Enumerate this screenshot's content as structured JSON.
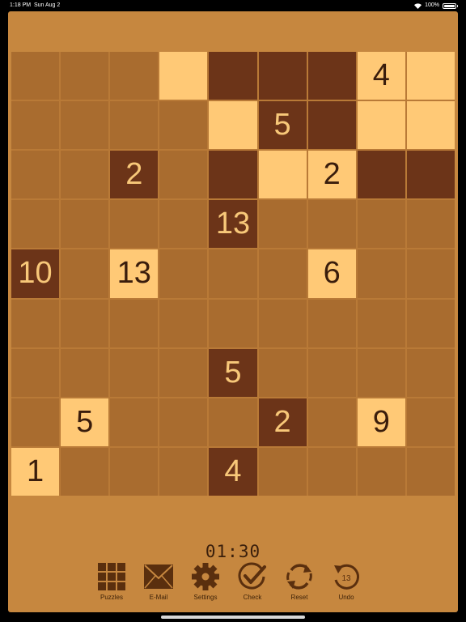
{
  "status_bar": {
    "time": "1:18 PM",
    "date": "Sun Aug 2",
    "battery": "100%",
    "battery_level": 1.0,
    "icons": [
      "wifi-icon",
      "battery-icon"
    ]
  },
  "board": {
    "size": 9,
    "rows": [
      [
        {
          "s": "b",
          "v": ""
        },
        {
          "s": "b",
          "v": ""
        },
        {
          "s": "b",
          "v": ""
        },
        {
          "s": "l",
          "v": ""
        },
        {
          "s": "d",
          "v": ""
        },
        {
          "s": "d",
          "v": ""
        },
        {
          "s": "d",
          "v": ""
        },
        {
          "s": "l",
          "v": "4"
        },
        {
          "s": "l",
          "v": ""
        }
      ],
      [
        {
          "s": "b",
          "v": ""
        },
        {
          "s": "b",
          "v": ""
        },
        {
          "s": "b",
          "v": ""
        },
        {
          "s": "b",
          "v": ""
        },
        {
          "s": "l",
          "v": ""
        },
        {
          "s": "d",
          "v": "5"
        },
        {
          "s": "d",
          "v": ""
        },
        {
          "s": "l",
          "v": ""
        },
        {
          "s": "l",
          "v": ""
        }
      ],
      [
        {
          "s": "b",
          "v": ""
        },
        {
          "s": "b",
          "v": ""
        },
        {
          "s": "d",
          "v": "2"
        },
        {
          "s": "b",
          "v": ""
        },
        {
          "s": "d",
          "v": ""
        },
        {
          "s": "l",
          "v": ""
        },
        {
          "s": "l",
          "v": "2"
        },
        {
          "s": "d",
          "v": ""
        },
        {
          "s": "d",
          "v": ""
        }
      ],
      [
        {
          "s": "b",
          "v": ""
        },
        {
          "s": "b",
          "v": ""
        },
        {
          "s": "b",
          "v": ""
        },
        {
          "s": "b",
          "v": ""
        },
        {
          "s": "d",
          "v": "13"
        },
        {
          "s": "b",
          "v": ""
        },
        {
          "s": "b",
          "v": ""
        },
        {
          "s": "b",
          "v": ""
        },
        {
          "s": "b",
          "v": ""
        }
      ],
      [
        {
          "s": "d",
          "v": "10"
        },
        {
          "s": "b",
          "v": ""
        },
        {
          "s": "l",
          "v": "13"
        },
        {
          "s": "b",
          "v": ""
        },
        {
          "s": "b",
          "v": ""
        },
        {
          "s": "b",
          "v": ""
        },
        {
          "s": "l",
          "v": "6"
        },
        {
          "s": "b",
          "v": ""
        },
        {
          "s": "b",
          "v": ""
        }
      ],
      [
        {
          "s": "b",
          "v": ""
        },
        {
          "s": "b",
          "v": ""
        },
        {
          "s": "b",
          "v": ""
        },
        {
          "s": "b",
          "v": ""
        },
        {
          "s": "b",
          "v": ""
        },
        {
          "s": "b",
          "v": ""
        },
        {
          "s": "b",
          "v": ""
        },
        {
          "s": "b",
          "v": ""
        },
        {
          "s": "b",
          "v": ""
        }
      ],
      [
        {
          "s": "b",
          "v": ""
        },
        {
          "s": "b",
          "v": ""
        },
        {
          "s": "b",
          "v": ""
        },
        {
          "s": "b",
          "v": ""
        },
        {
          "s": "d",
          "v": "5"
        },
        {
          "s": "b",
          "v": ""
        },
        {
          "s": "b",
          "v": ""
        },
        {
          "s": "b",
          "v": ""
        },
        {
          "s": "b",
          "v": ""
        }
      ],
      [
        {
          "s": "b",
          "v": ""
        },
        {
          "s": "l",
          "v": "5"
        },
        {
          "s": "b",
          "v": ""
        },
        {
          "s": "b",
          "v": ""
        },
        {
          "s": "b",
          "v": ""
        },
        {
          "s": "d",
          "v": "2"
        },
        {
          "s": "b",
          "v": ""
        },
        {
          "s": "l",
          "v": "9"
        },
        {
          "s": "b",
          "v": ""
        }
      ],
      [
        {
          "s": "l",
          "v": "1"
        },
        {
          "s": "b",
          "v": ""
        },
        {
          "s": "b",
          "v": ""
        },
        {
          "s": "b",
          "v": ""
        },
        {
          "s": "d",
          "v": "4"
        },
        {
          "s": "b",
          "v": ""
        },
        {
          "s": "b",
          "v": ""
        },
        {
          "s": "b",
          "v": ""
        },
        {
          "s": "b",
          "v": ""
        }
      ]
    ]
  },
  "timer": "01:30",
  "toolbar": {
    "items": [
      {
        "label": "Puzzles",
        "icon": "grid-icon"
      },
      {
        "label": "E-Mail",
        "icon": "envelope-icon"
      },
      {
        "label": "Settings",
        "icon": "gear-icon"
      },
      {
        "label": "Check",
        "icon": "checkmark-icon"
      },
      {
        "label": "Reset",
        "icon": "reset-icon"
      },
      {
        "label": "Undo",
        "icon": "undo-icon"
      }
    ],
    "undo_count": "13"
  },
  "colors": {
    "background": "#c6873f",
    "cell_blank": "#a96c2f",
    "cell_light": "#ffc976",
    "cell_dark": "#6c3418",
    "icon": "#5a2f0e"
  }
}
